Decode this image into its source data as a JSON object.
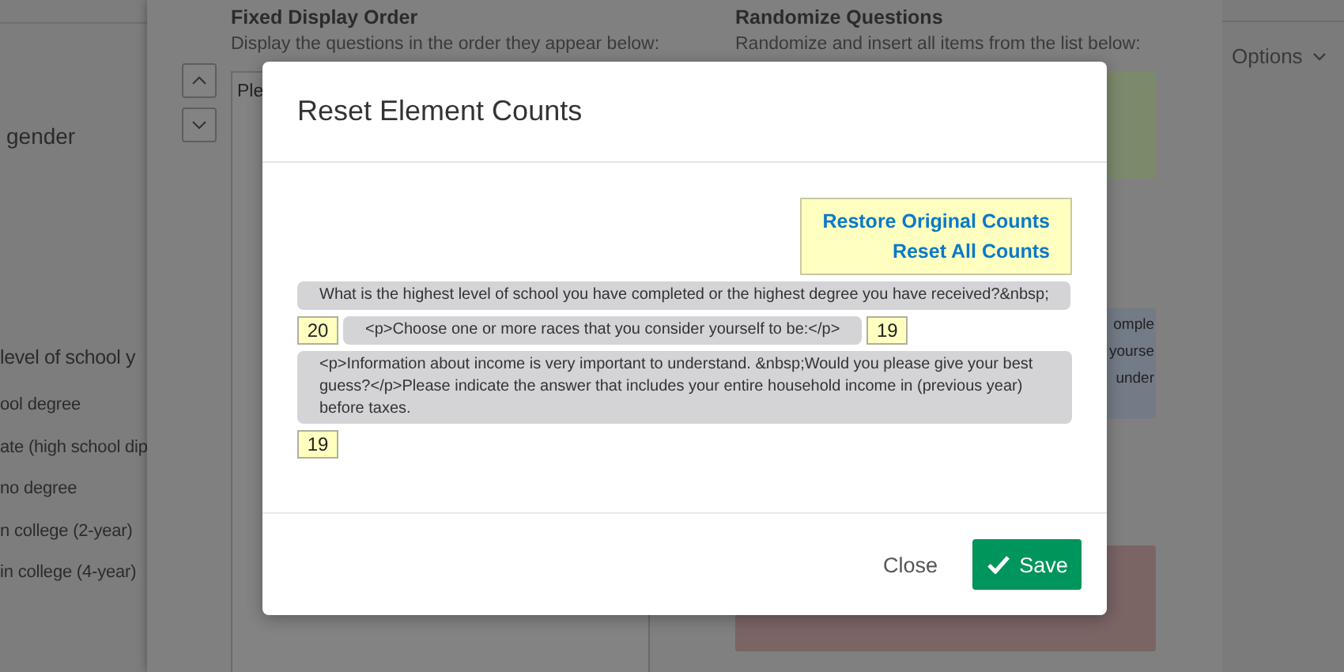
{
  "background": {
    "left_panel": {
      "texts": [
        "gender",
        "level of school y",
        "ool degree",
        "ate (high school dip",
        "no degree",
        "n college (2-year)",
        "in college (4-year)"
      ]
    },
    "fixed_column": {
      "title": "Fixed Display Order",
      "subtitle": "Display the questions in the order they appear below:",
      "list_text": "Ple"
    },
    "random_column": {
      "title": "Randomize Questions",
      "subtitle": "Randomize and insert all items from the list below:",
      "blue_box_texts": [
        "omple",
        "yourse",
        "under"
      ]
    },
    "right_panel": {
      "options_label": "Options"
    }
  },
  "dialog": {
    "title": "Reset Element Counts",
    "links": [
      "Restore Original Counts",
      "Reset All Counts"
    ],
    "rows": [
      {
        "text": "What is the highest level of school you have completed or the highest degree you have received?&nbsp;",
        "count": "20"
      },
      {
        "text": "<p>Choose one or more races that you consider yourself to be:</p>",
        "count": "19"
      },
      {
        "text": "<p>Information about income is very important to understand. &nbsp;Would you please give your best guess?</p>Please indicate the answer that includes your entire household income in (previous year) before taxes.",
        "count": "19"
      }
    ],
    "buttons": {
      "close": "Close",
      "save": "Save"
    }
  }
}
